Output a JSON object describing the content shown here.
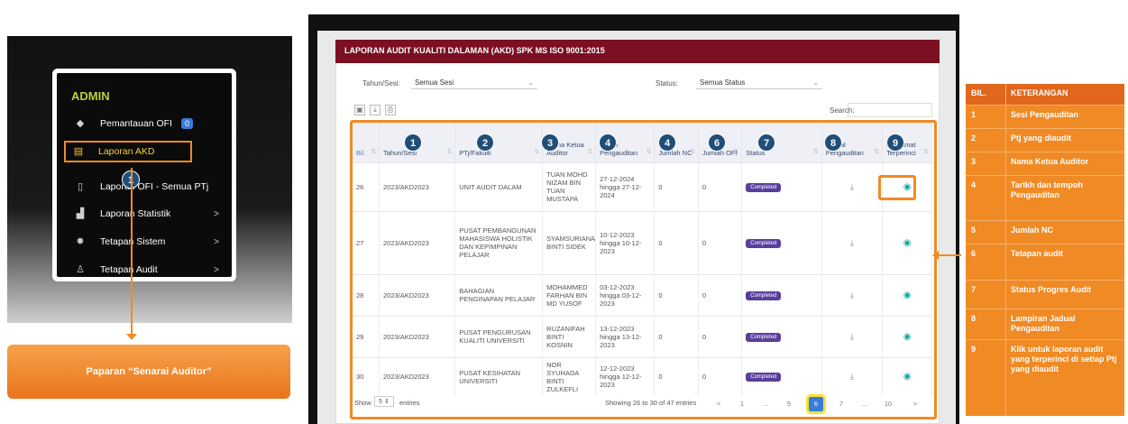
{
  "admin_panel": {
    "title": "ADMIN",
    "menu": [
      {
        "label": "Pemantauan OFI",
        "icon": "tags-icon",
        "badge": "0"
      },
      {
        "label": "Laporan AKD",
        "icon": "document-icon"
      },
      {
        "label": "Laporan OFI - Semua PTj",
        "icon": "report-icon"
      },
      {
        "label": "Laporan Statistik",
        "icon": "bar-chart-icon",
        "chevron": ">"
      },
      {
        "label": "Tetapan Sistem",
        "icon": "gear-icon",
        "chevron": ">"
      },
      {
        "label": "Tetapan Audit",
        "icon": "user-icon",
        "chevron": ">"
      }
    ],
    "marker": "1"
  },
  "callout": {
    "text": "Paparan “Senarai Auditor”"
  },
  "main": {
    "header_title": "LAPORAN AUDIT KUALITI DALAMAN (AKD) SPK MS ISO 9001:2015",
    "filters": {
      "session_label": "Tahun/Sesi:",
      "session_value": "Semua Sesi",
      "status_label": "Status:",
      "status_value": "Semua Status",
      "search_label": "Search:"
    },
    "column_markers": [
      "1",
      "2",
      "3",
      "4",
      "4",
      "6",
      "7",
      "8",
      "9"
    ],
    "columns": [
      "Bil.",
      "Tahun/Sesi",
      "PTj/Fakulti",
      "Nama Ketua Auditor",
      "Tarikh Pengauditan",
      "Jumlah NC",
      "Jumlah OFI",
      "Status",
      "Jadual Pengauditan",
      "Maklumat Terperinci"
    ],
    "rows": [
      {
        "bil": "26",
        "sesi": "2023/AKD2023",
        "ptj": "UNIT AUDIT DALAM",
        "ketua": "TUAN MOHD NIZAM BIN TUAN MUSTAPA",
        "tarikh": "27-12-2024 hingga 27-12-2024",
        "nc": "0",
        "ofi": "0",
        "status": "Completed"
      },
      {
        "bil": "27",
        "sesi": "2023/AKD2023",
        "ptj": "PUSAT PEMBANGUNAN MAHASISWA HOLISTIK DAN KEPIMPINAN PELAJAR",
        "ketua": "SYAMSURIANA BINTI SIDEK",
        "tarikh": "10-12-2023 hingga 10-12-2023",
        "nc": "0",
        "ofi": "0",
        "status": "Completed"
      },
      {
        "bil": "28",
        "sesi": "2023/AKD2023",
        "ptj": "BAHAGIAN PENGINAPAN PELAJAR",
        "ketua": "MOHAMMED FARHAN BIN MD YUSOF",
        "tarikh": "03-12-2023 hingga 03-12-2023",
        "nc": "0",
        "ofi": "0",
        "status": "Completed"
      },
      {
        "bil": "29",
        "sesi": "2023/AKD2023",
        "ptj": "PUSAT PENGURUSAN KUALITI UNIVERSITI",
        "ketua": "RUZANIFAH BINTI KOSNIN",
        "tarikh": "13-12-2023 hingga 13-12-2023",
        "nc": "0",
        "ofi": "0",
        "status": "Completed"
      },
      {
        "bil": "30",
        "sesi": "2023/AKD2023",
        "ptj": "PUSAT KESIHATAN UNIVERSITI",
        "ketua": "NOR SYUHADA BINTI ZULKEFLI",
        "tarikh": "12-12-2023 hingga 12-12-2023",
        "nc": "0",
        "ofi": "0",
        "status": "Completed"
      }
    ],
    "footer": {
      "show_label": "Show",
      "show_value": "5",
      "entries_label": "entries",
      "info": "Showing 26 to 30 of 47 entries",
      "pages": [
        "<",
        "1",
        "...",
        "5",
        "6",
        "7",
        "...",
        "10",
        ">"
      ]
    }
  },
  "legend": {
    "header": {
      "n": "BIL.",
      "t": "KETERANGAN"
    },
    "rows": [
      {
        "n": "1",
        "t": "Sesi Pengauditan"
      },
      {
        "n": "2",
        "t": "Ptj yang diaudit"
      },
      {
        "n": "3",
        "t": "Nama Ketua Auditor"
      },
      {
        "n": "4",
        "t": "Tarikh dan tempoh Pengauditan"
      },
      {
        "n": "5",
        "t": "Jumlah NC"
      },
      {
        "n": "6",
        "t": "Tetapan audit"
      },
      {
        "n": "7",
        "t": "Status Progres Audit"
      },
      {
        "n": "8",
        "t": "Lampiran Jadual Pengauditan"
      },
      {
        "n": "9",
        "t": "Klik untuk laporan audit yang terperinci di setiap Ptj yang diaudit"
      }
    ]
  },
  "colors": {
    "accent": "#f08a24",
    "header": "#7b1022",
    "marker": "#1f4e79",
    "status": "#5a3e9b"
  }
}
